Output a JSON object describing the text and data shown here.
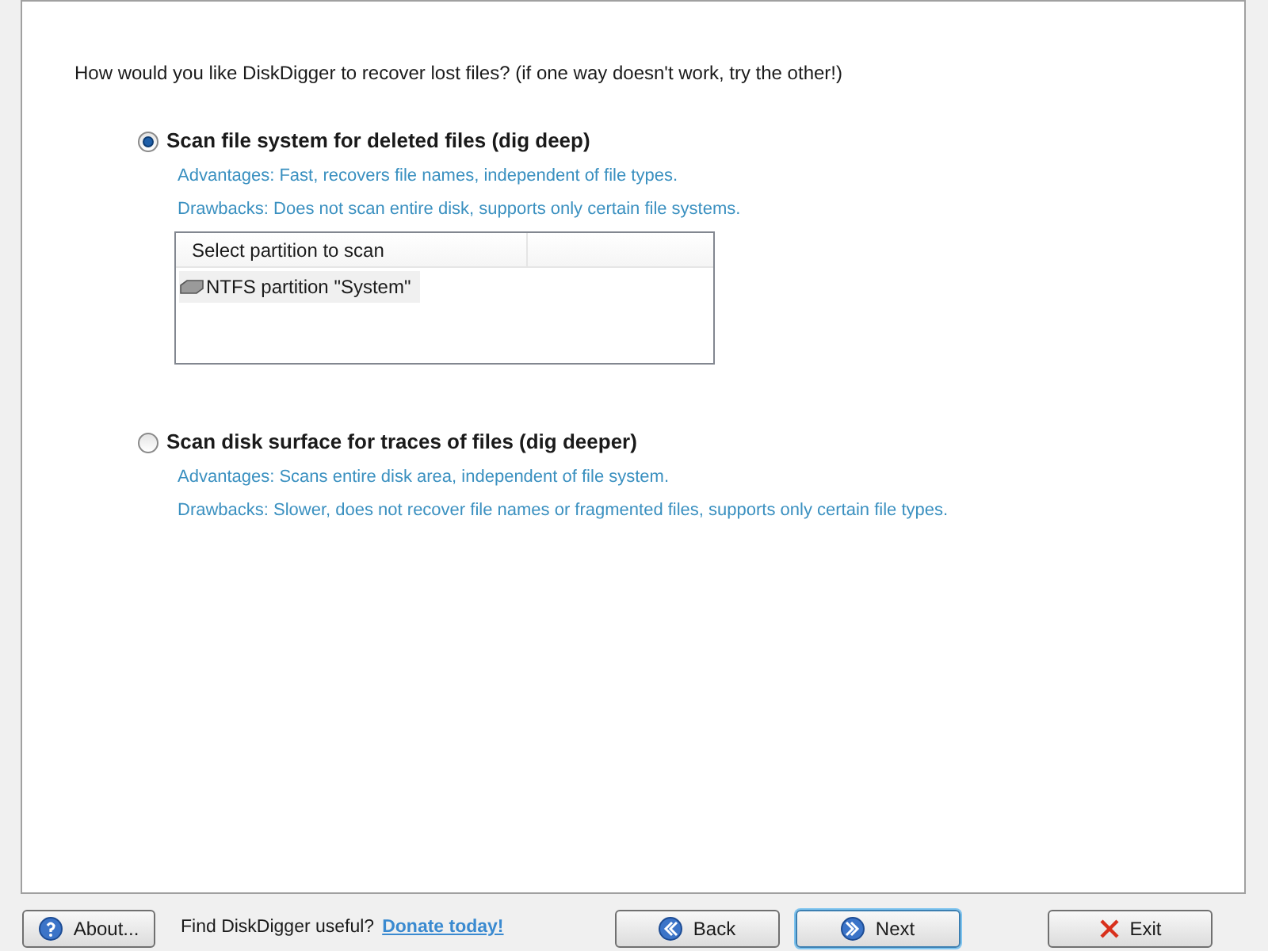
{
  "question": "How would you like DiskDigger to recover lost files? (if one way doesn't work, try the other!)",
  "options": [
    {
      "label": "Scan file system for deleted files (dig deep)",
      "selected": true,
      "advantages": "Advantages: Fast, recovers file names, independent of file types.",
      "drawbacks": "Drawbacks: Does not scan entire disk, supports only certain file systems.",
      "partition_list": {
        "header": "Select partition to scan",
        "items": [
          {
            "label": "NTFS partition \"System\"",
            "selected": true
          }
        ]
      }
    },
    {
      "label": "Scan disk surface for traces of files (dig deeper)",
      "selected": false,
      "advantages": "Advantages: Scans entire disk area, independent of file system.",
      "drawbacks": "Drawbacks: Slower, does not recover file names or fragmented files, supports only certain file types."
    }
  ],
  "footer": {
    "about": "About...",
    "prompt": "Find DiskDigger useful?",
    "donate_link": "Donate today!",
    "buttons": [
      {
        "kind": "back",
        "label": "Back",
        "focused": false
      },
      {
        "kind": "next",
        "label": "Next",
        "focused": true
      },
      {
        "kind": "exit",
        "label": "Exit",
        "focused": false
      }
    ]
  }
}
